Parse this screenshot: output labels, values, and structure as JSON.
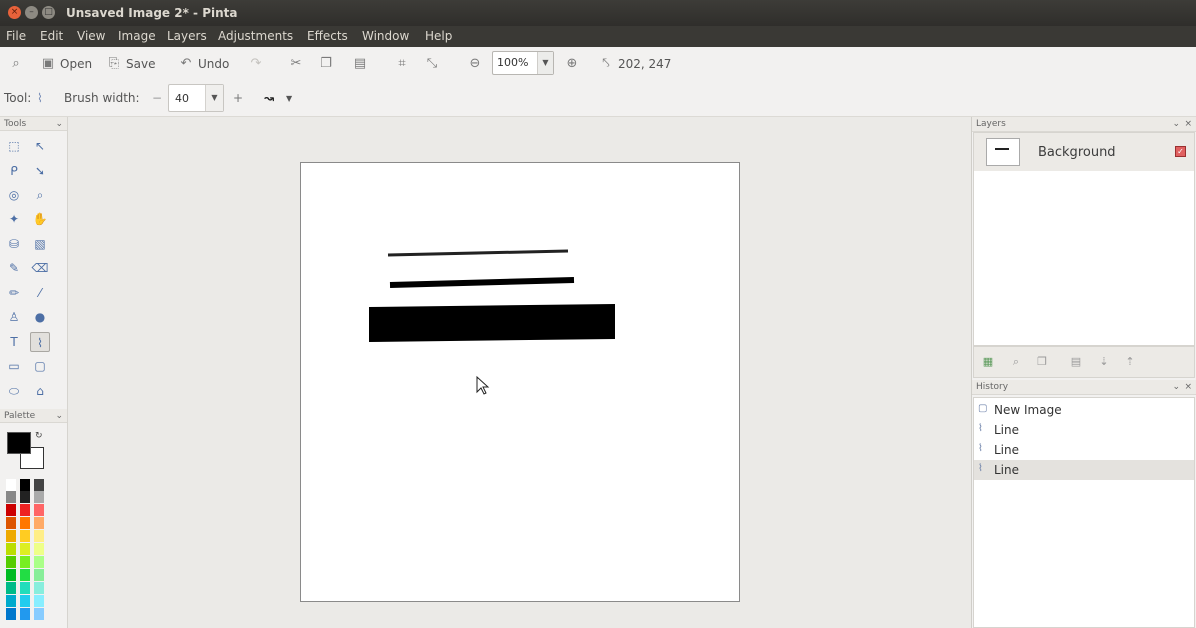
{
  "window": {
    "title": "Unsaved Image 2* - Pinta",
    "controls": [
      "close",
      "minimize",
      "maximize"
    ]
  },
  "menubar": {
    "items": [
      "File",
      "Edit",
      "View",
      "Image",
      "Layers",
      "Adjustments",
      "Effects",
      "Window",
      "Help"
    ]
  },
  "toolbar": {
    "open_label": "Open",
    "save_label": "Save",
    "undo_label": "Undo",
    "zoom_value": "100%",
    "cursor_position": "202, 247"
  },
  "tool_options": {
    "tool_label": "Tool:",
    "brush_width_label": "Brush width:",
    "brush_width_value": "40"
  },
  "tools_panel": {
    "title": "Tools",
    "active_tool": "line-curve"
  },
  "palette_panel": {
    "title": "Palette",
    "primary_color": "#000000",
    "secondary_color": "#ffffff"
  },
  "layers_panel": {
    "title": "Layers",
    "layers": [
      {
        "name": "Background",
        "visible": true
      }
    ]
  },
  "history_panel": {
    "title": "History",
    "items": [
      {
        "label": "New Image",
        "icon": "new-image-icon"
      },
      {
        "label": "Line",
        "icon": "line-icon"
      },
      {
        "label": "Line",
        "icon": "line-icon"
      },
      {
        "label": "Line",
        "icon": "line-icon",
        "selected": true
      }
    ]
  },
  "canvas": {
    "background": "#ffffff",
    "stroke_color": "#000000"
  }
}
